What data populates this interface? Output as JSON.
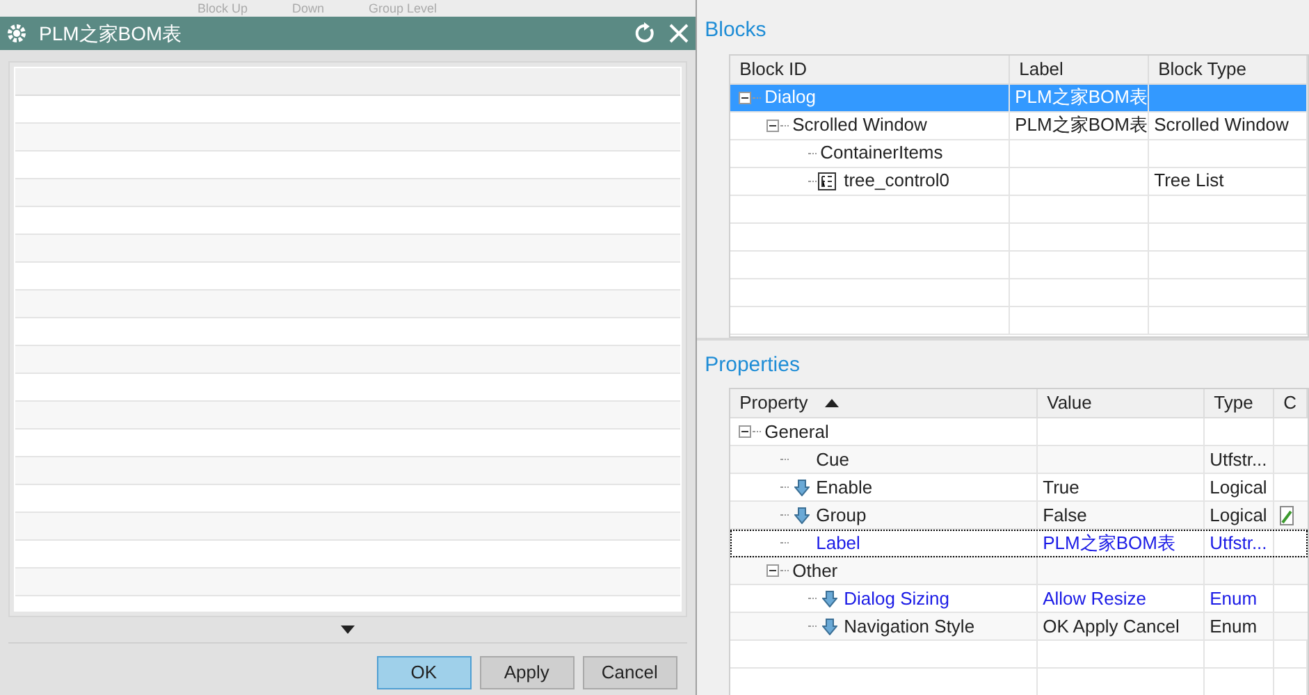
{
  "background_toolbar": {
    "items": [
      "Block Up",
      "Down",
      "Group Level"
    ]
  },
  "dialog": {
    "title": "PLM之家BOM表",
    "buttons": [
      {
        "label": "OK",
        "default": true
      },
      {
        "label": "Apply",
        "default": false
      },
      {
        "label": "Cancel",
        "default": false
      }
    ]
  },
  "blocks": {
    "title": "Blocks",
    "columns": [
      "Block ID",
      "Label",
      "Block Type"
    ],
    "rows": [
      {
        "block_id": "Dialog",
        "label": "PLM之家BOM表",
        "selected": true,
        "expanded": true,
        "children": [
          {
            "block_id": "Scrolled Window",
            "label": "PLM之家BOM表",
            "block_type": "Scrolled Window",
            "selected": false,
            "expanded": true,
            "children": [
              {
                "block_id": "ContainerItems",
                "selected": false
              },
              {
                "block_id": "tree_control0",
                "block_type": "Tree List",
                "selected": false,
                "kind": "tree-list"
              }
            ]
          }
        ]
      }
    ]
  },
  "properties": {
    "title": "Properties",
    "columns": [
      "Property",
      "Value",
      "Type",
      "C"
    ],
    "rows": [
      {
        "property": "General",
        "expanded": true,
        "children": [
          {
            "property": "Cue",
            "type": "Utfstr...",
            "kind": "plain",
            "modified": false
          },
          {
            "property": "Enable",
            "value": "True",
            "type": "Logical",
            "kind": "arrow",
            "modified": false
          },
          {
            "property": "Group",
            "value": "False",
            "type": "Logical",
            "kind": "arrow",
            "modified": false,
            "editable": true
          },
          {
            "property": "Label",
            "value": "PLM之家BOM表",
            "type": "Utfstr...",
            "kind": "plain",
            "modified": true,
            "focused": true
          },
          {
            "property": "Other",
            "expanded": true,
            "children": [
              {
                "property": "Dialog Sizing",
                "value": "Allow Resize",
                "type": "Enum",
                "kind": "arrow",
                "modified": true
              },
              {
                "property": "Navigation Style",
                "value": "OK Apply Cancel",
                "type": "Enum",
                "kind": "arrow",
                "modified": false
              }
            ]
          }
        ]
      }
    ]
  }
}
